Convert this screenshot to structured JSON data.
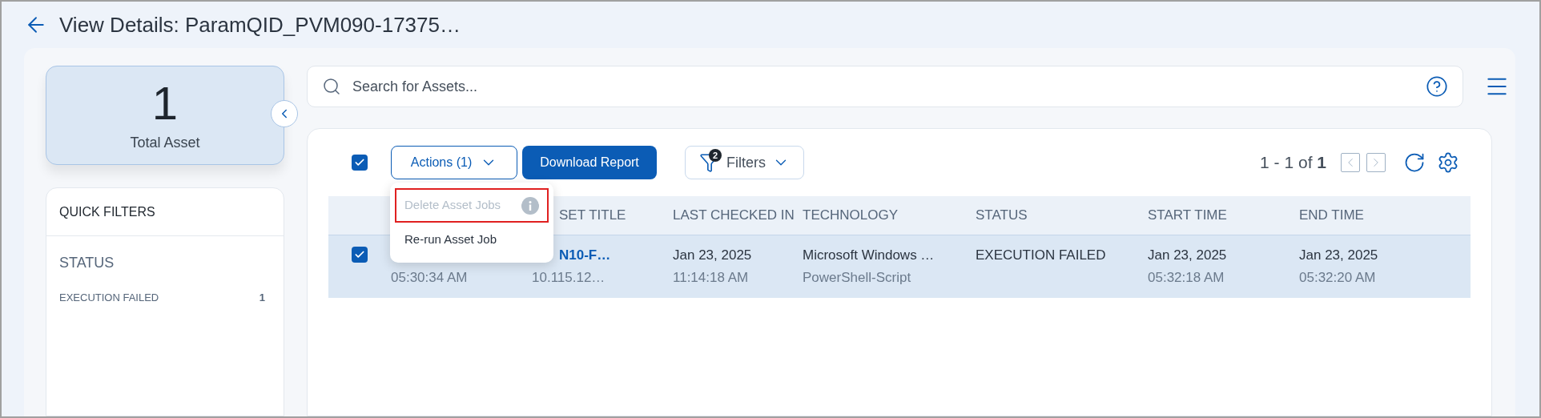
{
  "title": "View Details: ParamQID_PVM090-17375…",
  "total_asset": {
    "count": "1",
    "label": "Total Asset"
  },
  "quick_filters": {
    "title": "QUICK FILTERS",
    "groups": [
      {
        "title": "STATUS",
        "items": [
          {
            "label": "EXECUTION FAILED",
            "count": "1"
          }
        ]
      }
    ]
  },
  "search": {
    "placeholder": "Search for Assets..."
  },
  "toolbar": {
    "select_all": {
      "checked": true
    },
    "actions": "Actions (1)",
    "download": "Download Report",
    "filters": {
      "label": "Filters",
      "badge": "2"
    },
    "pagination": {
      "range": "1 - 1 of",
      "total": "1"
    }
  },
  "actions_menu": [
    {
      "label": "Delete Asset Jobs",
      "disabled": true,
      "outlined": true
    },
    {
      "label": "Re-run Asset Job",
      "disabled": false,
      "outlined": false
    }
  ],
  "table": {
    "columns": [
      "",
      "SET TITLE",
      "LAST CHECKED IN",
      "TECHNOLOGY",
      "STATUS",
      "START TIME",
      "END TIME"
    ],
    "rows": [
      {
        "selected": true,
        "cells": [
          {
            "secondary": "05:30:34 AM"
          },
          {
            "primary": "N10-F…",
            "secondary": "10.115.12…",
            "kind": "link"
          },
          {
            "primary": "Jan 23, 2025",
            "secondary": "11:14:18 AM"
          },
          {
            "primary": "Microsoft Windows …",
            "secondary": "PowerShell-Script"
          },
          {
            "primary": "EXECUTION FAILED"
          },
          {
            "primary": "Jan 23, 2025",
            "secondary": "05:32:18 AM"
          },
          {
            "primary": "Jan 23, 2025",
            "secondary": "05:32:20 AM"
          }
        ]
      }
    ]
  }
}
